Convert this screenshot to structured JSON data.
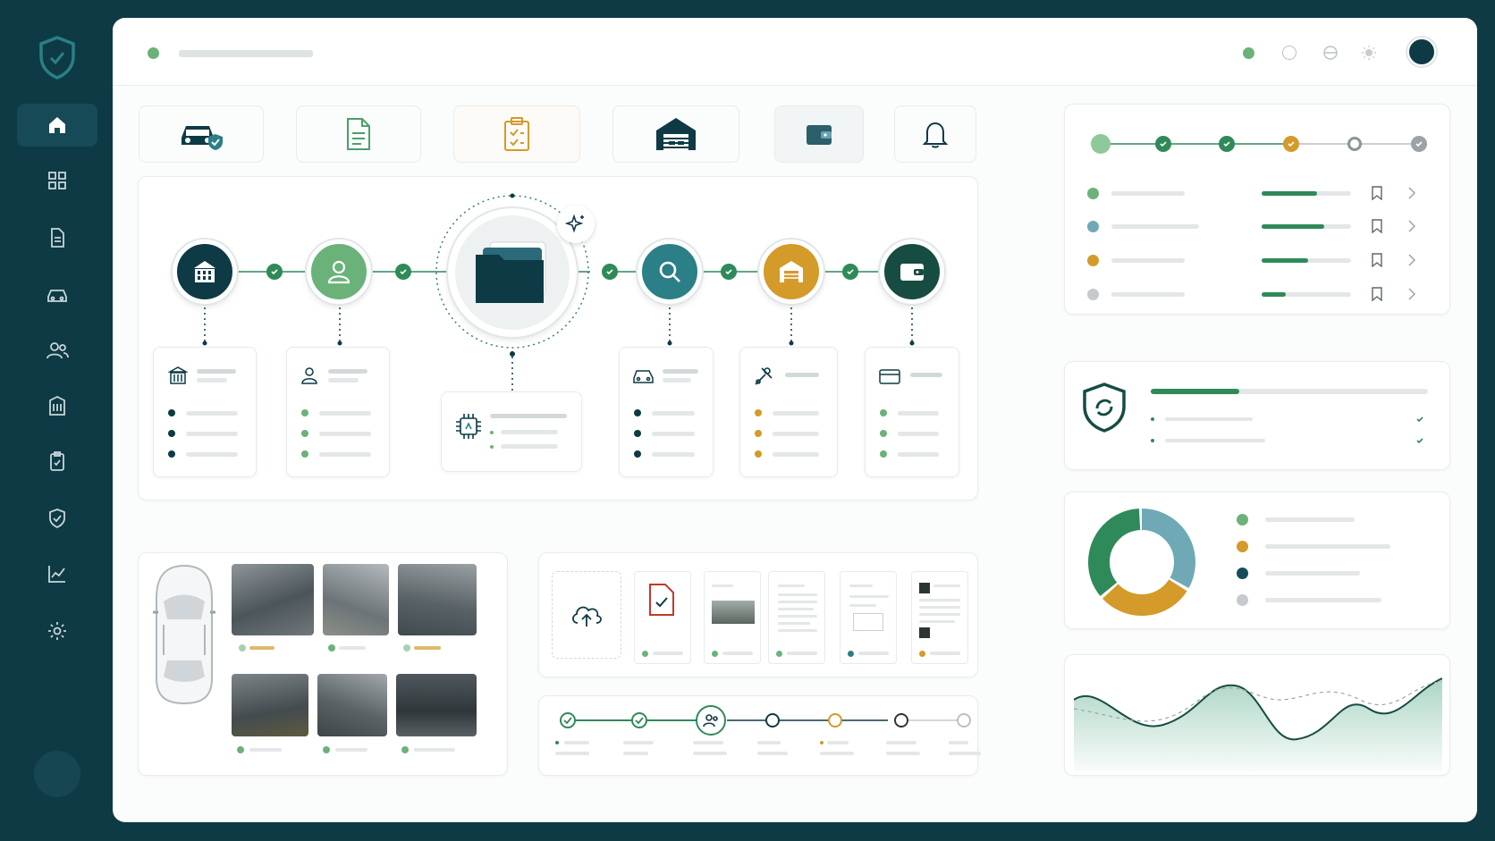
{
  "colors": {
    "navy": "#0d3a45",
    "green": "#2f8a5a",
    "lightgreen": "#6bb27a",
    "teal": "#2b7f86",
    "gold": "#d49a2a",
    "gray": "#b9c0c3"
  },
  "sidebar": {
    "items": [
      "home-icon",
      "grid-icon",
      "document-icon",
      "car-icon",
      "users-icon",
      "building-icon",
      "clipboard-icon",
      "shield-icon",
      "chart-icon",
      "gear-icon"
    ],
    "active": "home-icon"
  },
  "top_tiles": [
    "car-shield-icon",
    "document-icon",
    "clipboard-check-icon",
    "garage-icon",
    "wallet-icon",
    "bell-icon"
  ],
  "workflow": {
    "nodes": [
      "building-icon",
      "user-icon",
      "folder-icon",
      "search-icon",
      "garage-icon",
      "wallet-icon"
    ]
  },
  "progress_list": {
    "fills": [
      0.62,
      0.7,
      0.52,
      0.27
    ]
  },
  "donut": {
    "segments": [
      {
        "value": 0.34,
        "color": "#6fa9b5"
      },
      {
        "value": 0.3,
        "color": "#d49a2a"
      },
      {
        "value": 0.36,
        "color": "#2f8a5a"
      }
    ]
  },
  "stepper": {
    "steps": [
      "done",
      "done",
      "active",
      "pending",
      "current",
      "pending",
      "pending"
    ]
  }
}
